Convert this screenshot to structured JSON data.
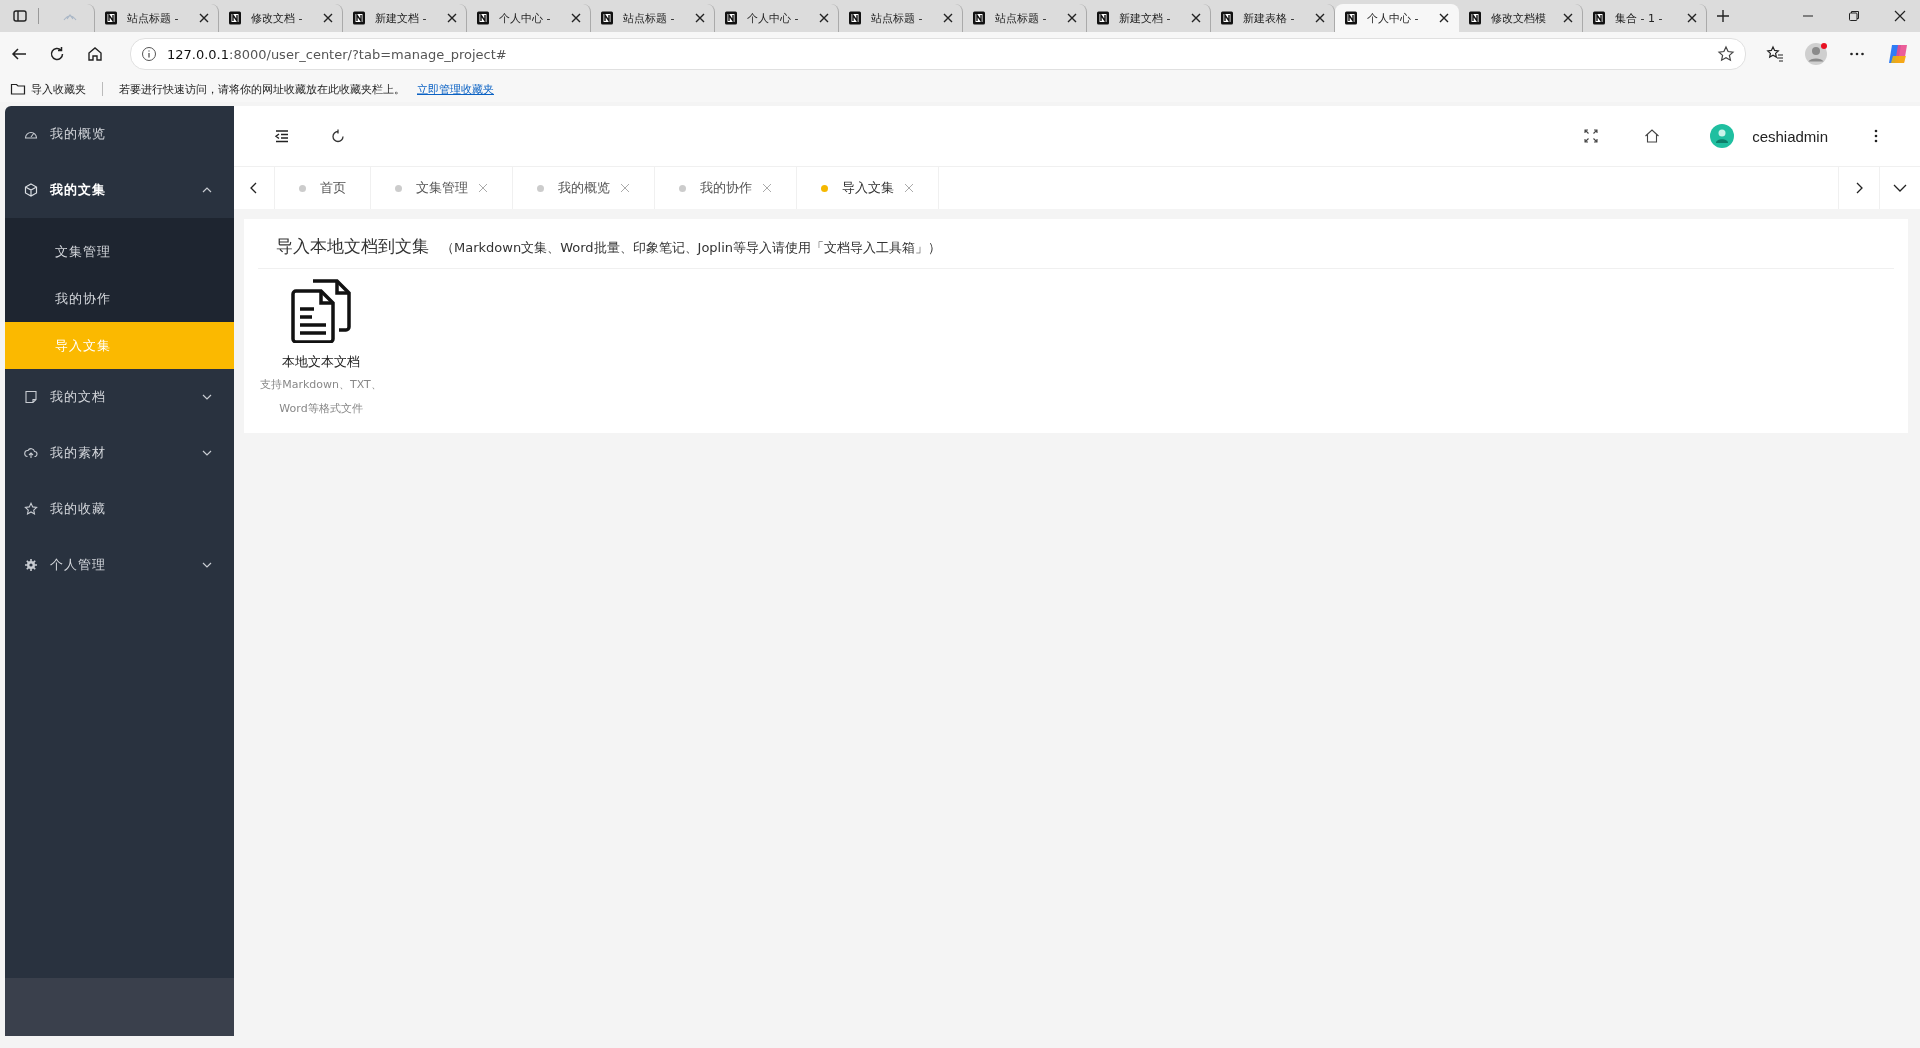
{
  "browser": {
    "tabs": [
      {
        "title": "站点标题 -",
        "selected": false
      },
      {
        "title": "修改文档 -",
        "selected": false
      },
      {
        "title": "新建文档 -",
        "selected": false
      },
      {
        "title": "个人中心 -",
        "selected": false
      },
      {
        "title": "站点标题 -",
        "selected": false
      },
      {
        "title": "个人中心 -",
        "selected": false
      },
      {
        "title": "站点标题 -",
        "selected": false
      },
      {
        "title": "站点标题 -",
        "selected": false
      },
      {
        "title": "新建文档 -",
        "selected": false
      },
      {
        "title": "新建表格 -",
        "selected": false
      },
      {
        "title": "个人中心 -",
        "selected": true
      },
      {
        "title": "修改文档模",
        "selected": false
      },
      {
        "title": "集合 - 1 -",
        "selected": false
      }
    ],
    "address": {
      "host": "127.0.0.1",
      "path": ":8000/user_center/?tab=manage_project#"
    },
    "bookmarks_bar": {
      "import": "导入收藏夹",
      "hint": "若要进行快速访问，请将你的网址收藏放在此收藏夹栏上。",
      "link": "立即管理收藏夹"
    }
  },
  "sidebar": {
    "items": [
      {
        "label": "我的概览"
      },
      {
        "label": "我的文集",
        "expanded": true,
        "children": [
          {
            "label": "文集管理",
            "selected": false
          },
          {
            "label": "我的协作",
            "selected": false
          },
          {
            "label": "导入文集",
            "selected": true
          }
        ]
      },
      {
        "label": "我的文档",
        "expanded": false
      },
      {
        "label": "我的素材",
        "expanded": false
      },
      {
        "label": "我的收藏"
      },
      {
        "label": "个人管理",
        "expanded": false
      }
    ]
  },
  "header": {
    "user": "ceshiadmin"
  },
  "page_tabs": [
    {
      "label": "首页",
      "selected": false,
      "closable": false
    },
    {
      "label": "文集管理",
      "selected": false,
      "closable": true
    },
    {
      "label": "我的概览",
      "selected": false,
      "closable": true
    },
    {
      "label": "我的协作",
      "selected": false,
      "closable": true
    },
    {
      "label": "导入文集",
      "selected": true,
      "closable": true
    }
  ],
  "content": {
    "title": "导入本地文档到文集",
    "note": "（Markdown文集、Word批量、印象笔记、Joplin等导入请使用「文档导入工具箱」）",
    "options": [
      {
        "title": "本地文本文档",
        "description": "支持Markdown、TXT、Word等格式文件"
      }
    ]
  }
}
